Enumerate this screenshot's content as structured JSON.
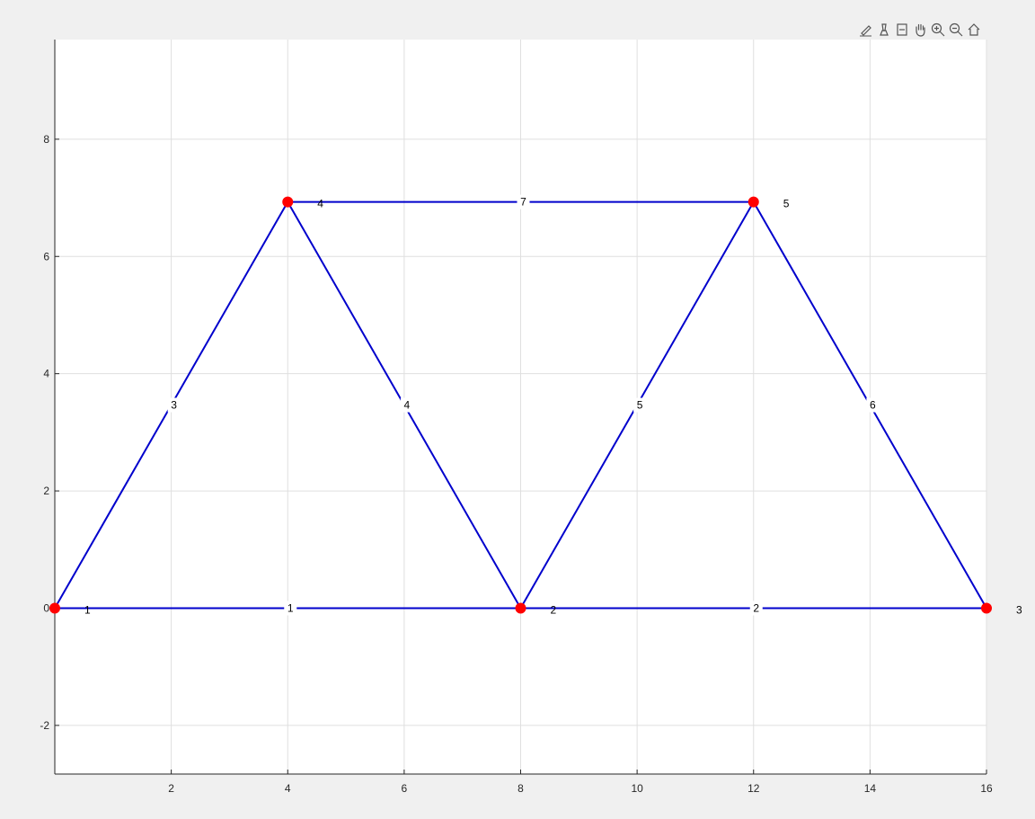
{
  "toolbar": {
    "buttons": [
      {
        "icon": "data-tips-icon"
      },
      {
        "icon": "brush-icon"
      },
      {
        "icon": "restore-view-icon"
      },
      {
        "icon": "pan-hand-icon"
      },
      {
        "icon": "zoom-in-icon"
      },
      {
        "icon": "zoom-out-icon"
      },
      {
        "icon": "home-icon"
      }
    ]
  },
  "colors": {
    "background": "#f0f0f0",
    "axes": "#ffffff",
    "grid": "#dfdfdf",
    "member": "#0000cc",
    "node": "#ff0000",
    "axis_line": "#262626"
  },
  "chart_data": {
    "type": "scatter",
    "xlim": [
      0,
      16
    ],
    "ylim": [
      -2.83,
      9.7
    ],
    "grid": true,
    "xticks": [
      2,
      4,
      6,
      8,
      10,
      12,
      14,
      16
    ],
    "xtick_labels": [
      "2",
      "4",
      "6",
      "8",
      "10",
      "12",
      "14",
      "16"
    ],
    "yticks": [
      -2,
      0,
      2,
      4,
      6,
      8
    ],
    "ytick_labels": [
      "-2",
      "0",
      "2",
      "4",
      "6",
      "8"
    ],
    "nodes": [
      {
        "x": 0,
        "y": 0,
        "label": "1"
      },
      {
        "x": 8,
        "y": 0,
        "label": "2"
      },
      {
        "x": 16,
        "y": 0,
        "label": "3"
      },
      {
        "x": 4,
        "y": 6.93,
        "label": "4"
      },
      {
        "x": 12,
        "y": 6.93,
        "label": "5"
      }
    ],
    "elements": [
      {
        "from": 0,
        "to": 1,
        "label": "1"
      },
      {
        "from": 1,
        "to": 2,
        "label": "2"
      },
      {
        "from": 0,
        "to": 3,
        "label": "3"
      },
      {
        "from": 3,
        "to": 1,
        "label": "4"
      },
      {
        "from": 1,
        "to": 4,
        "label": "5"
      },
      {
        "from": 4,
        "to": 2,
        "label": "6"
      },
      {
        "from": 3,
        "to": 4,
        "label": "7"
      }
    ]
  }
}
